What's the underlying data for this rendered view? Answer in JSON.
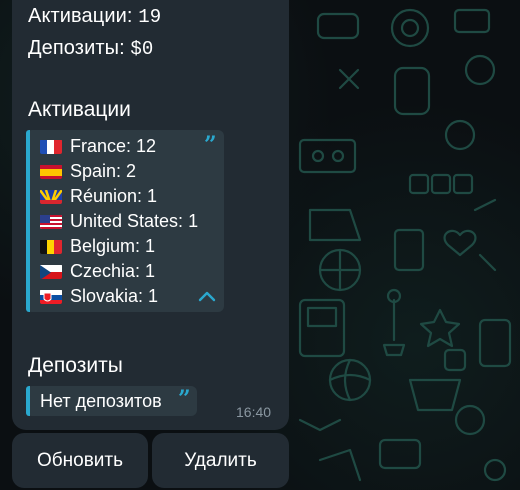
{
  "message": {
    "activations_label": "Активации:",
    "activations_value": "19",
    "deposits_label": "Депозиты:",
    "deposits_value": "$0",
    "activations_heading": "Активации",
    "countries": [
      {
        "name": "France: 12",
        "flag": "france"
      },
      {
        "name": "Spain: 2",
        "flag": "spain"
      },
      {
        "name": "Réunion: 1",
        "flag": "reunion"
      },
      {
        "name": "United States: 1",
        "flag": "usa"
      },
      {
        "name": "Belgium: 1",
        "flag": "belgium"
      },
      {
        "name": "Czechia: 1",
        "flag": "czechia"
      },
      {
        "name": "Slovakia: 1",
        "flag": "slovakia"
      }
    ],
    "deposits_heading": "Депозиты",
    "no_deposits": "Нет депозитов",
    "time": "16:40"
  },
  "buttons": {
    "refresh": "Обновить",
    "delete": "Удалить"
  },
  "colors": {
    "accent": "#2aa8ce",
    "bubble": "#222b33",
    "quote_bg": "#2d3a42",
    "pattern": "#1f4a43"
  }
}
